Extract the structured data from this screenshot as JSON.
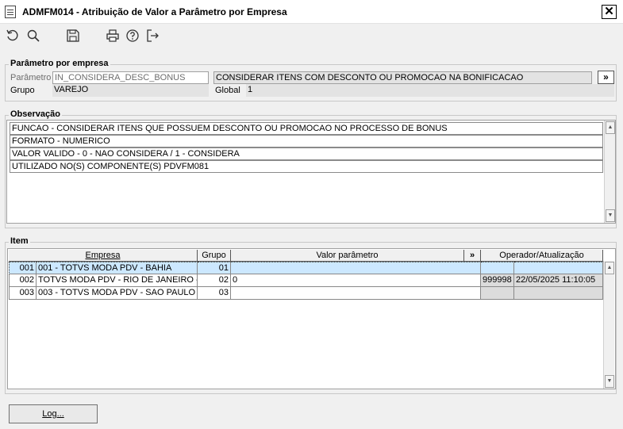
{
  "window": {
    "title": "ADMFM014 - Atribuição de Valor a Parâmetro por Empresa",
    "close_glyph": "✕"
  },
  "toolbar": {
    "buttons": [
      "refresh-icon",
      "search-icon",
      "save-icon",
      "print-icon",
      "help-icon",
      "exit-icon"
    ]
  },
  "parametro_group": {
    "title": "Parâmetro por empresa",
    "parametro_label": "Parâmetro",
    "parametro_value": "IN_CONSIDERA_DESC_BONUS",
    "descricao_value": "CONSIDERAR ITENS COM DESCONTO OU PROMOCAO NA BONIFICACAO",
    "more_button": "»",
    "grupo_label": "Grupo",
    "grupo_value": "VAREJO",
    "global_label": "Global",
    "global_value": "1"
  },
  "observacao": {
    "title": "Observação",
    "lines": [
      "FUNCAO - CONSIDERAR ITENS QUE POSSUEM DESCONTO OU PROMOCAO NO PROCESSO DE BONUS",
      "FORMATO - NUMERICO",
      "VALOR VALIDO - 0 - NAO CONSIDERA / 1 - CONSIDERA",
      "UTILIZADO NO(S) COMPONENTE(S) PDVFM081"
    ]
  },
  "item": {
    "title": "Item",
    "columns": {
      "empresa": "Empresa",
      "grupo": "Grupo",
      "valor": "Valor parâmetro",
      "more": "»",
      "operador": "Operador/Atualização"
    },
    "rows": [
      {
        "num": "001",
        "empresa": "001 - TOTVS MODA PDV - BAHIA",
        "grupo": "01",
        "valor": "",
        "operador": "",
        "data": ""
      },
      {
        "num": "002",
        "empresa": "TOTVS MODA PDV - RIO DE JANEIRO - N",
        "grupo": "02",
        "valor": "0",
        "operador": "999998",
        "data": "22/05/2025 11:10:05"
      },
      {
        "num": "003",
        "empresa": "003 - TOTVS MODA PDV - SAO PAULO",
        "grupo": "03",
        "valor": "",
        "operador": "",
        "data": ""
      }
    ]
  },
  "footer": {
    "log_button": "Log..."
  }
}
